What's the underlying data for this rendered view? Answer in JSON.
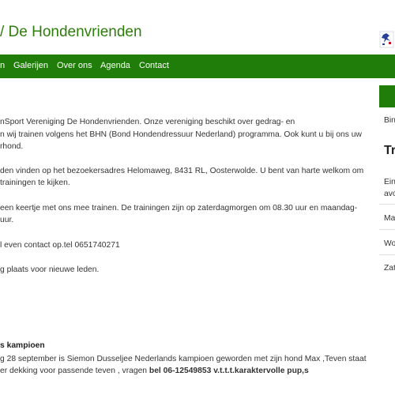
{
  "header": {
    "title": "/ De Hondenvrienden"
  },
  "nav": {
    "items": [
      {
        "label": "n"
      },
      {
        "label": "Galerijen"
      },
      {
        "label": "Over ons"
      },
      {
        "label": "Agenda"
      },
      {
        "label": "Contact"
      }
    ]
  },
  "main": {
    "lines": [
      "nSport Vereniging De Hondenvrienden. Onze vereniging beschikt over gedrag- en",
      "n wij trainen volgens het BHN (Bond Hondendressuur Nederland) programma. Ook kunt u bij ons uw",
      "rhond.",
      "den vinden op het bezoekersadres Helomaweg, 8431 RL, Oosterwolde. U bent van harte welkom om",
      " trainingen te kijken.",
      " een keertje met ons mee trainen. De trainingen zijn op zaterdagmorgen om 08.30 uur en maandag-",
      "uur.",
      "l even contact op.tel 0651740271",
      "g plaats voor nieuwe leden."
    ],
    "news": {
      "title": "s kampioen",
      "line1": "g 28 september is Siemon Dusseljee Nederlands kampioen geworden met zijn hond Max ,Teven staat",
      "line2_prefix": "er dekking voor passende teven , vragen ",
      "line2_bold": "bel 06-12549853 v.t.t.t.karaktervolle pup,s"
    }
  },
  "sidebar": {
    "top_text": "Bin",
    "heading": "Tr",
    "items": [
      "Ein",
      "avo",
      "Ma",
      "Wo",
      "Zat"
    ]
  },
  "colors": {
    "brand_green": "#217d0a",
    "title_green": "#2e7d0d"
  }
}
